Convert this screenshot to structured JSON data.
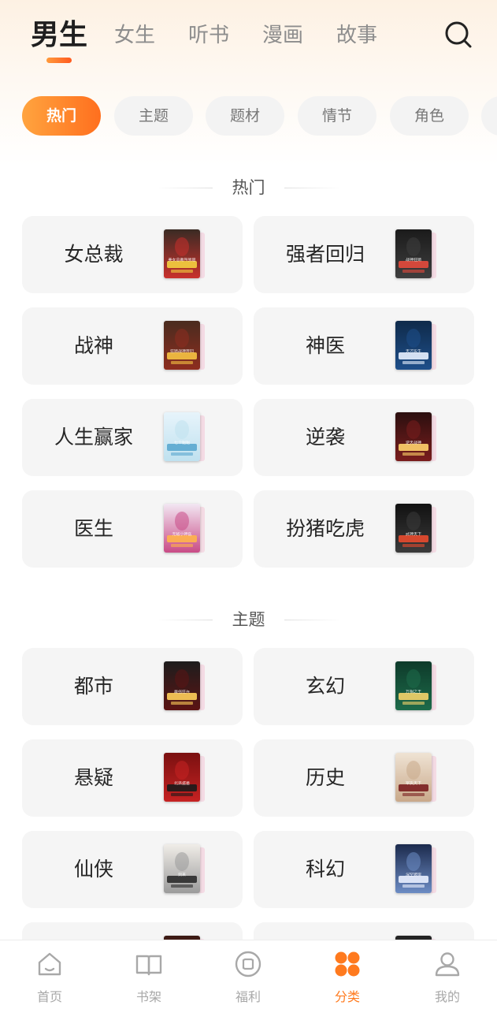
{
  "header": {
    "tabs": [
      {
        "label": "男生",
        "active": true
      },
      {
        "label": "女生",
        "active": false
      },
      {
        "label": "听书",
        "active": false
      },
      {
        "label": "漫画",
        "active": false
      },
      {
        "label": "故事",
        "active": false
      }
    ],
    "search_icon": "search-icon"
  },
  "filters": {
    "chips": [
      {
        "label": "热门",
        "active": true
      },
      {
        "label": "主题",
        "active": false
      },
      {
        "label": "题材",
        "active": false
      },
      {
        "label": "情节",
        "active": false
      },
      {
        "label": "角色",
        "active": false
      }
    ]
  },
  "sections": [
    {
      "title": "热门",
      "items": [
        {
          "label": "女总裁",
          "cover_text": "美女总裁叫我爸",
          "cover_colors": [
            "#3a2b24",
            "#c9302c",
            "#f4d03f"
          ]
        },
        {
          "label": "强者回归",
          "cover_text": "战神狂婿",
          "cover_colors": [
            "#1b1b1b",
            "#3e3e3e",
            "#e64a3c"
          ]
        },
        {
          "label": "战神",
          "cover_text": "狂婿战神弃妇",
          "cover_colors": [
            "#4a2c1f",
            "#8e2d1f",
            "#f6c343"
          ]
        },
        {
          "label": "神医",
          "cover_text": "天才医生",
          "cover_colors": [
            "#0f2a4a",
            "#1e4f8a",
            "#e8f1ff"
          ]
        },
        {
          "label": "人生赢家",
          "cover_text": "七个姐姐",
          "cover_colors": [
            "#e7f4fb",
            "#bfe1ef",
            "#5aa7cf"
          ]
        },
        {
          "label": "逆袭",
          "cover_text": "逆天战神",
          "cover_colors": [
            "#2b0f0f",
            "#7a1d1d",
            "#ffd36b"
          ]
        },
        {
          "label": "医生",
          "cover_text": "无敌小神医",
          "cover_colors": [
            "#f2e7f3",
            "#c94b86",
            "#ffb44a"
          ]
        },
        {
          "label": "扮猪吃虎",
          "cover_text": "武神天下",
          "cover_colors": [
            "#111111",
            "#3b3b3b",
            "#e94b2f"
          ]
        }
      ]
    },
    {
      "title": "主题",
      "items": [
        {
          "label": "都市",
          "cover_text": "最强狂兵",
          "cover_colors": [
            "#1d1d1d",
            "#5b1414",
            "#ffcf5a"
          ]
        },
        {
          "label": "玄幻",
          "cover_text": "万相之王",
          "cover_colors": [
            "#0e3a2a",
            "#1d6b4a",
            "#f5d36a"
          ]
        },
        {
          "label": "悬疑",
          "cover_text": "北派盗墓",
          "cover_colors": [
            "#7a1010",
            "#c62222",
            "#1b1b1b"
          ]
        },
        {
          "label": "历史",
          "cover_text": "宰执天下",
          "cover_colors": [
            "#efe3d4",
            "#c9a98a",
            "#7a1f1f"
          ]
        },
        {
          "label": "仙侠",
          "cover_text": "剑来",
          "cover_colors": [
            "#f0ede8",
            "#9b9b9b",
            "#2b2b2b"
          ]
        },
        {
          "label": "科幻",
          "cover_text": "深空彼岸",
          "cover_colors": [
            "#1c2a4d",
            "#6c8cc4",
            "#e9f0ff"
          ]
        },
        {
          "label": "",
          "cover_text": "",
          "cover_colors": [
            "#3a1a14",
            "#a03020",
            "#ffcc66"
          ]
        },
        {
          "label": "",
          "cover_text": "",
          "cover_colors": [
            "#222222",
            "#444444",
            "#888888"
          ]
        }
      ]
    }
  ],
  "bottom_nav": [
    {
      "label": "首页",
      "icon": "home-icon",
      "active": false
    },
    {
      "label": "书架",
      "icon": "bookshelf-icon",
      "active": false
    },
    {
      "label": "福利",
      "icon": "welfare-icon",
      "active": false
    },
    {
      "label": "分类",
      "icon": "category-icon",
      "active": true
    },
    {
      "label": "我的",
      "icon": "profile-icon",
      "active": false
    }
  ],
  "colors": {
    "accent": "#ff7a1e",
    "accent_light": "#ffa43f",
    "card_bg": "#f5f5f5",
    "inactive_text": "#a8a8a8"
  }
}
